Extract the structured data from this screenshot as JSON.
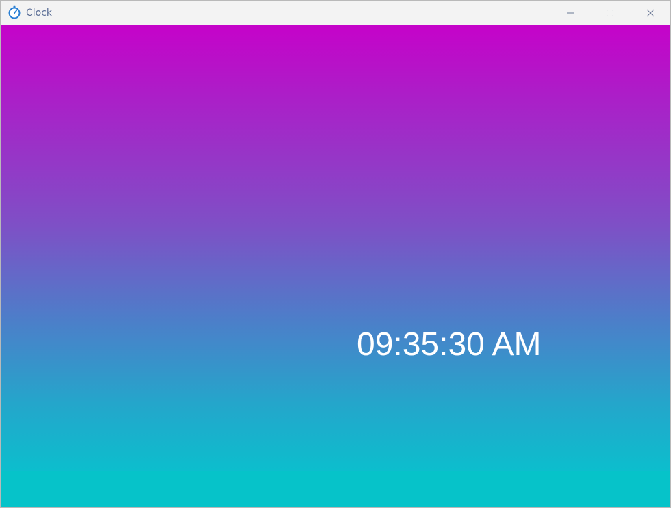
{
  "window": {
    "title": "Clock",
    "icon": "stopwatch-icon",
    "controls": {
      "minimize": "minimize-icon",
      "maximize": "maximize-icon",
      "close": "close-icon"
    }
  },
  "clock": {
    "time": "09:35:30 AM"
  },
  "colors": {
    "gradient_top": "#c503c9",
    "gradient_bottom": "#0cbecd",
    "bottom_bar": "#06c3c9",
    "time_text": "#ffffff",
    "title_text": "#5b6e96"
  }
}
